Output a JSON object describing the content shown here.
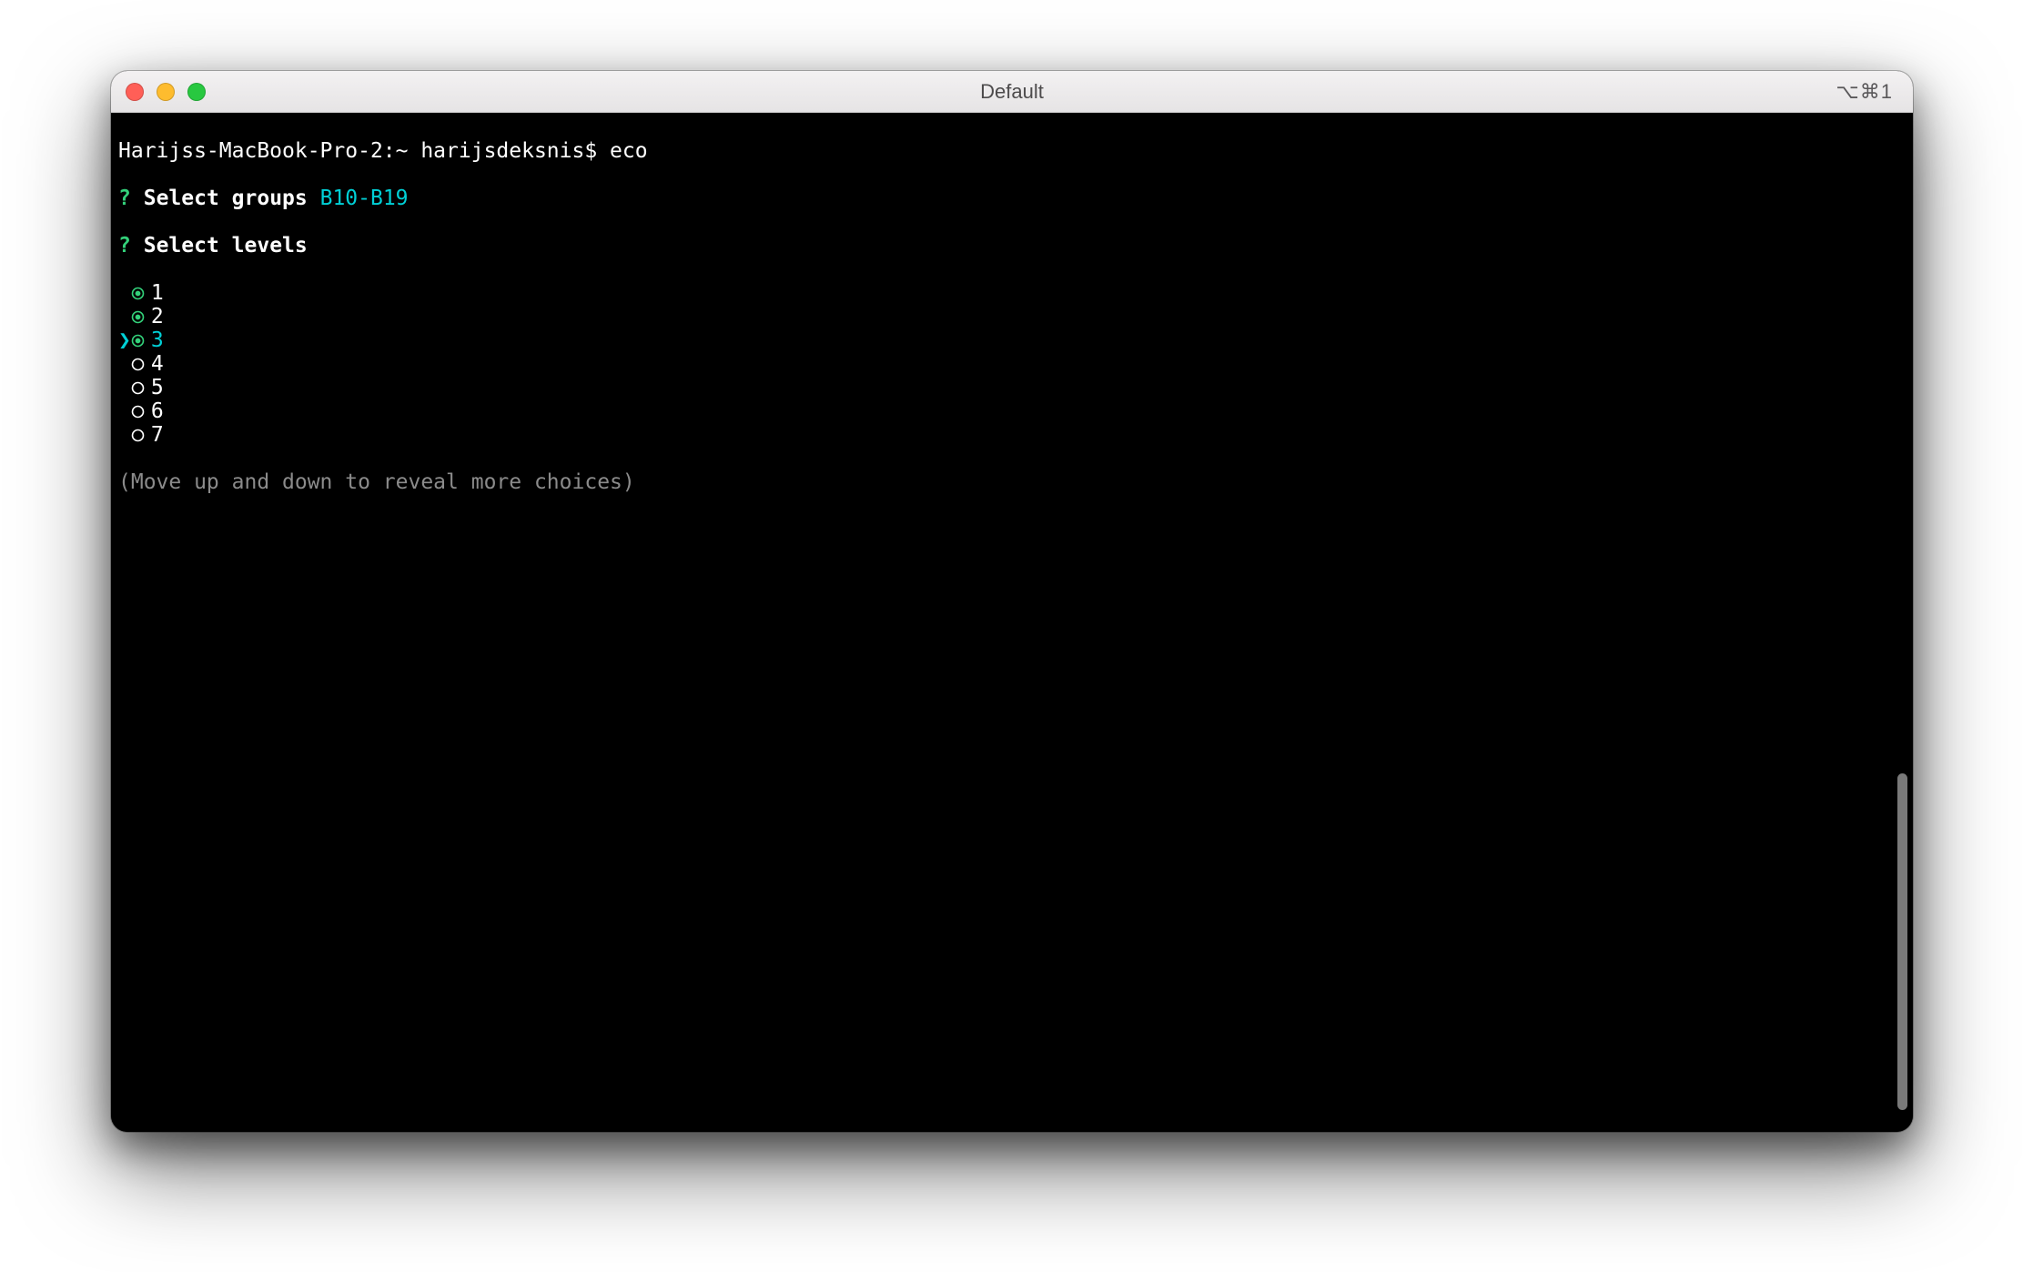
{
  "window": {
    "title": "Default",
    "shortcut": "⌥⌘1"
  },
  "colors": {
    "green": "#33d17a",
    "cyan": "#00d0d6",
    "white": "#ffffff",
    "dim": "#8b8b8b",
    "bg": "#000000",
    "titlebar_text": "#4d4b4c"
  },
  "prompt": {
    "host_path": "Harijss-MacBook-Pro-2:~ harijsdeksnis$ ",
    "command": "eco"
  },
  "lines": {
    "groups_qmark": "?",
    "groups_label": "Select groups",
    "groups_answer": "B10-B19",
    "levels_qmark": "?",
    "levels_label": "Select levels"
  },
  "choices": [
    {
      "label": "1",
      "selected": true,
      "cursor": false
    },
    {
      "label": "2",
      "selected": true,
      "cursor": false
    },
    {
      "label": "3",
      "selected": true,
      "cursor": true
    },
    {
      "label": "4",
      "selected": false,
      "cursor": false
    },
    {
      "label": "5",
      "selected": false,
      "cursor": false
    },
    {
      "label": "6",
      "selected": false,
      "cursor": false
    },
    {
      "label": "7",
      "selected": false,
      "cursor": false
    }
  ],
  "hint": "(Move up and down to reveal more choices)"
}
